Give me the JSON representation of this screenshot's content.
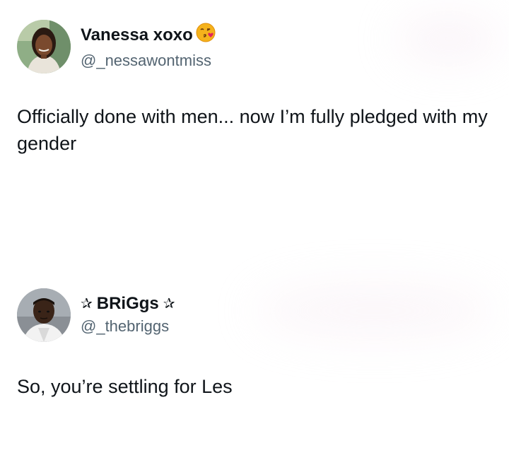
{
  "tweets": [
    {
      "author": {
        "display_name": "Vanessa xoxo",
        "emoji_icon": "kissing-face-icon",
        "handle": "@_nessawontmiss"
      },
      "text": "Officially done with men... now I’m fully pledged with my gender"
    },
    {
      "author": {
        "display_name": "BRiGgs",
        "decoration_left": "✰",
        "decoration_right": "✰",
        "handle": "@_thebriggs"
      },
      "text": "So, you’re settling for Les"
    }
  ]
}
